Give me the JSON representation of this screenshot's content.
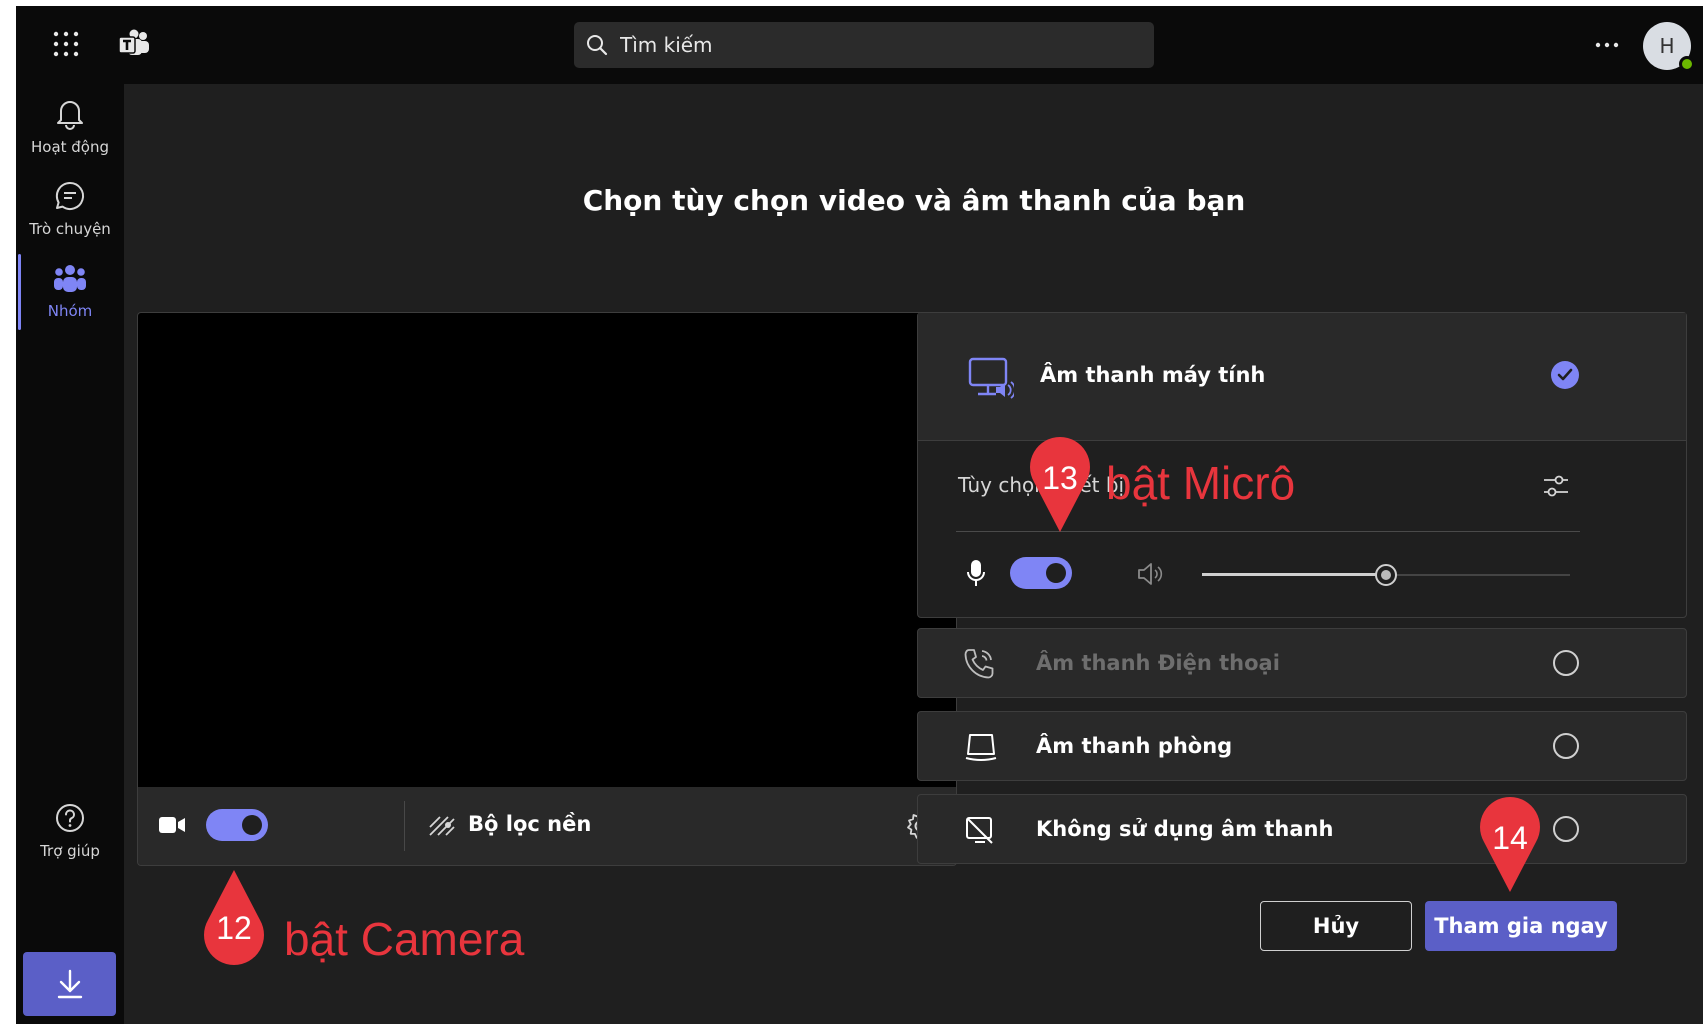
{
  "search": {
    "placeholder": "Tìm kiếm"
  },
  "avatar": {
    "initial": "H"
  },
  "rail": {
    "items": [
      {
        "label": "Hoạt động",
        "icon": "bell-icon"
      },
      {
        "label": "Trò chuyện",
        "icon": "chat-icon"
      },
      {
        "label": "Nhóm",
        "icon": "teams-icon",
        "active": true
      }
    ],
    "help_label": "Trợ giúp"
  },
  "prejoin": {
    "title": "Chọn tùy chọn video và âm thanh của bạn",
    "camera_on": true,
    "background_filter_label": "Bộ lọc nền"
  },
  "audio": {
    "options": [
      {
        "label": "Âm thanh máy tính",
        "selected": true
      },
      {
        "label": "Âm thanh Điện thoại",
        "selected": false,
        "disabled": true
      },
      {
        "label": "Âm thanh phòng",
        "selected": false
      },
      {
        "label": "Không sử dụng âm thanh",
        "selected": false
      }
    ],
    "device_settings_label": "Tùy chọn thiết bị",
    "mic_on": true,
    "speaker_volume": 0.5
  },
  "actions": {
    "cancel_label": "Hủy",
    "join_label": "Tham gia ngay"
  },
  "annotations": [
    {
      "number": "12",
      "label": "bật Camera"
    },
    {
      "number": "13",
      "label": "bật Micrô"
    },
    {
      "number": "14",
      "label": ""
    }
  ],
  "colors": {
    "accent": "#7f85f5",
    "primary_button": "#5b5fc7",
    "annotation": "#e8353d"
  }
}
